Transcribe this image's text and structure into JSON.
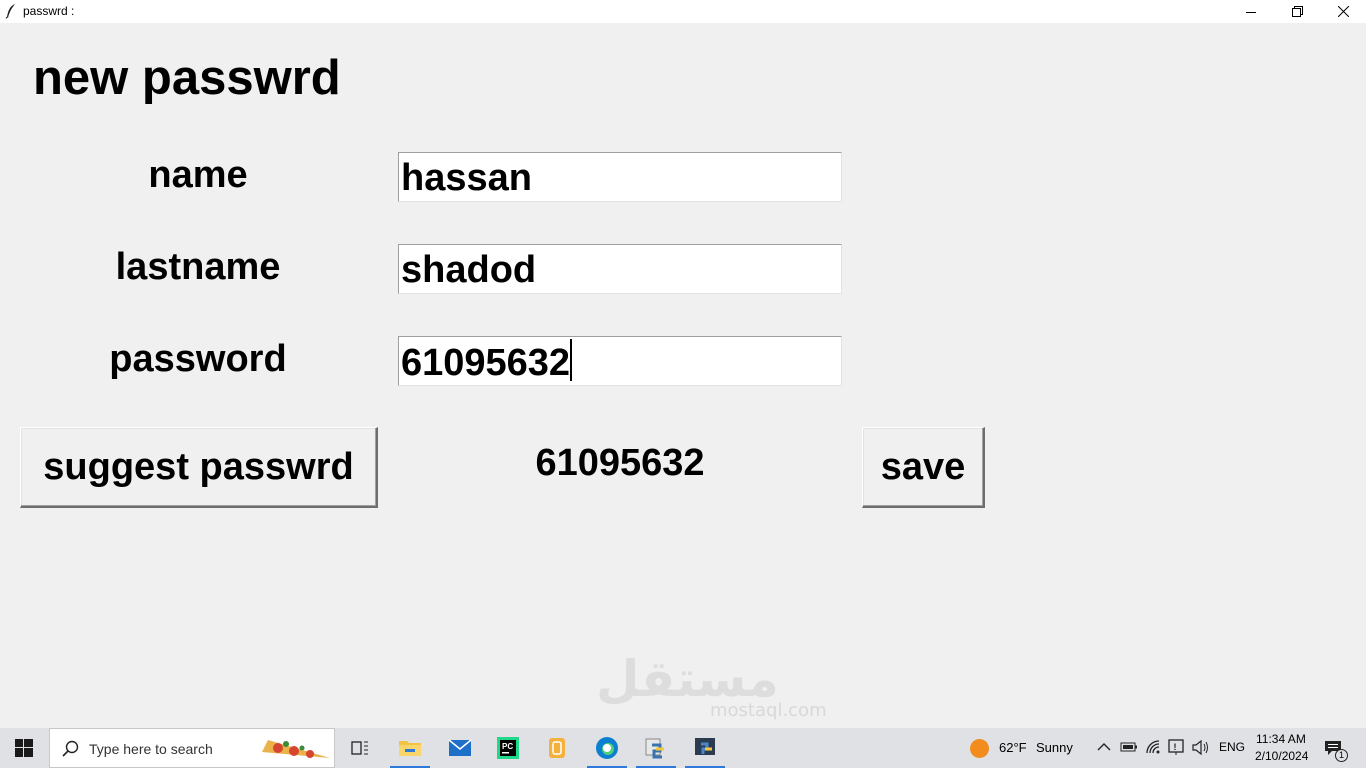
{
  "window": {
    "title": "passwrd :",
    "minimize_glyph": "—",
    "restore_glyph": "❐",
    "close_glyph": "✕"
  },
  "form": {
    "heading": "new passwrd",
    "fields": [
      {
        "label": "name",
        "value": "hassan"
      },
      {
        "label": "lastname",
        "value": "shadod"
      },
      {
        "label": "password",
        "value": "61095632"
      }
    ],
    "suggest_button": "suggest passwrd",
    "suggested_value": "61095632",
    "save_button": "save"
  },
  "watermark": {
    "text": "مستقل",
    "subtext": "mostaql.com"
  },
  "taskbar": {
    "search_placeholder": "Type here to search",
    "weather_temp": "62°F",
    "weather_desc": "Sunny",
    "language": "ENG",
    "time": "11:34 AM",
    "date": "2/10/2024",
    "notification_count": "1",
    "accent": "#2f79d8"
  }
}
